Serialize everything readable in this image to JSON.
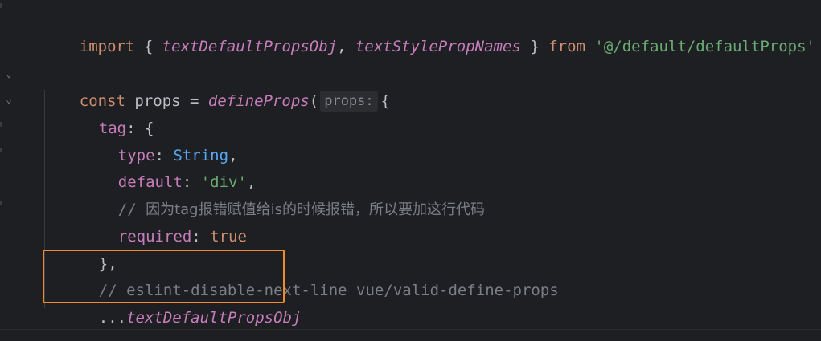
{
  "editor": {
    "lines": {
      "l1": {
        "import": "import",
        "brace_open": " { ",
        "name1": "textDefaultPropsObj",
        "comma": ", ",
        "name2": "textStylePropNames",
        "brace_close": " } ",
        "from": "from",
        "space": " ",
        "path": "'@/default/defaultProps'"
      },
      "l3": {
        "const": "const",
        "decl": " props = ",
        "fn": "defineProps",
        "paren": "(",
        "hint": "props:",
        "brace": "{"
      },
      "l4": {
        "key": "tag",
        "rest": ": {"
      },
      "l5": {
        "key": "type",
        "colon": ": ",
        "value": "String",
        "comma": ","
      },
      "l6": {
        "key": "default",
        "colon": ": ",
        "value": "'div'",
        "comma": ","
      },
      "l7": {
        "comment": "// ",
        "comment_text": "因为tag报错赋值给is的时候报错，所以要加这行代码"
      },
      "l8": {
        "key": "required",
        "colon": ": ",
        "value": "true"
      },
      "l9": {
        "text": "},"
      },
      "l10": {
        "comment": "// eslint-disable-next-line vue/valid-define-props"
      },
      "l11": {
        "spread": "...",
        "name": "textDefaultPropsObj"
      },
      "l12": {
        "text": "})"
      }
    }
  },
  "colors": {
    "background": "#1e1f22",
    "keyword": "#cf8e6d",
    "function": "#c77dbb",
    "string": "#6aab73",
    "type": "#56a8f5",
    "comment": "#7a7e85",
    "highlight_box": "#f28a2a"
  },
  "icons": {
    "fold1": "chevron-down-icon",
    "fold2": "chevron-down-icon"
  }
}
